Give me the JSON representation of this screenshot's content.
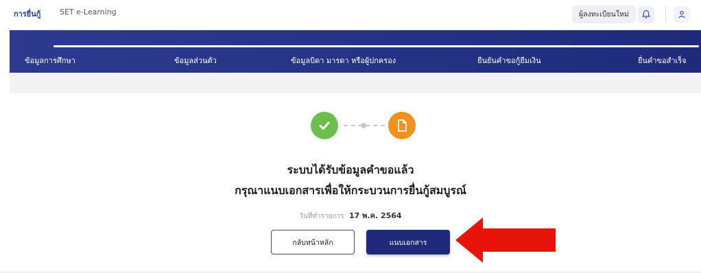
{
  "header": {
    "brand": "การยื่นกู้",
    "secondary_link": "SET e-Learning",
    "register_label": "ผู้ลงทะเบียนใหม่"
  },
  "steps": [
    {
      "label": "ข้อมูลการศึกษา"
    },
    {
      "label": "ข้อมูลส่วนตัว"
    },
    {
      "label": "ข้อมูลบิดา มารดา หรือผู้ปกครอง"
    },
    {
      "label": "ยืนยันคำขอกู้ยืมเงิน"
    },
    {
      "label": "ยื่นคำขอสำเร็จ"
    }
  ],
  "progress": {
    "fraction_complete": 1.0
  },
  "main": {
    "message_line1": "ระบบได้รับข้อมูลคำขอแล้ว",
    "message_line2": "กรุณาแนบเอกสารเพื่อให้กระบวนการยื่นกู้สมบูรณ์",
    "date_label": "วันที่ทำรายการ",
    "date_value": "17 พ.ค. 2564",
    "home_button": "กลับหน้าหลัก",
    "attach_button": "แนบเอกสาร"
  },
  "colors": {
    "nav_blue": "#243283",
    "success_green": "#6bc04b",
    "pending_orange": "#f5901e",
    "arrow_red": "#e8140a"
  },
  "icons": {
    "status_done": "check-icon",
    "status_pending": "document-icon",
    "notification": "bell-icon",
    "account": "user-icon",
    "annotation": "arrow-left-icon"
  }
}
